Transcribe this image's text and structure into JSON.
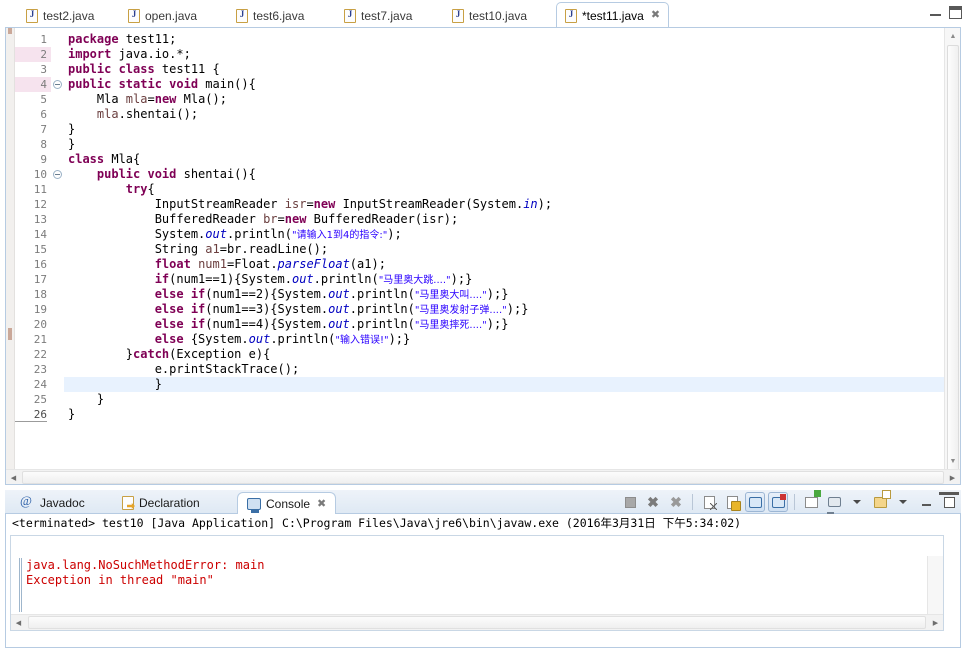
{
  "editor": {
    "tabs": [
      {
        "label": "test2.java",
        "icon": "java-file-icon",
        "active": false,
        "dirty": false
      },
      {
        "label": "open.java",
        "icon": "java-file-icon",
        "active": false,
        "dirty": false
      },
      {
        "label": "test6.java",
        "icon": "java-file-icon",
        "active": false,
        "dirty": false
      },
      {
        "label": "test7.java",
        "icon": "java-file-icon",
        "active": false,
        "dirty": false
      },
      {
        "label": "test10.java",
        "icon": "java-file-icon",
        "active": false,
        "dirty": false
      },
      {
        "label": "*test11.java",
        "icon": "java-file-icon",
        "active": true,
        "dirty": true,
        "close": "✖"
      }
    ],
    "window_buttons": {
      "minimize": "minimize-icon",
      "maximize": "maximize-icon"
    },
    "current_line": 24,
    "highlighted_gutter_lines": [
      2,
      4
    ],
    "fold_lines": [
      4,
      10
    ],
    "change_bar_lines": [
      10,
      25
    ],
    "lines": [
      {
        "n": 1,
        "segments": [
          {
            "t": "package ",
            "c": "kw"
          },
          {
            "t": "test11;",
            "c": ""
          }
        ]
      },
      {
        "n": 2,
        "segments": [
          {
            "t": "import ",
            "c": "kw"
          },
          {
            "t": "java.io.*;",
            "c": ""
          }
        ]
      },
      {
        "n": 3,
        "segments": [
          {
            "t": "public class ",
            "c": "kw"
          },
          {
            "t": "test11 {",
            "c": ""
          }
        ]
      },
      {
        "n": 4,
        "segments": [
          {
            "t": "public static void ",
            "c": "kw"
          },
          {
            "t": "main(){",
            "c": ""
          }
        ]
      },
      {
        "n": 5,
        "segments": [
          {
            "t": "    Mla ",
            "c": ""
          },
          {
            "t": "mla",
            "c": "loc"
          },
          {
            "t": "=",
            "c": ""
          },
          {
            "t": "new ",
            "c": "kw"
          },
          {
            "t": "Mla();",
            "c": ""
          }
        ]
      },
      {
        "n": 6,
        "segments": [
          {
            "t": "    ",
            "c": ""
          },
          {
            "t": "mla",
            "c": "loc"
          },
          {
            "t": ".shentai();",
            "c": ""
          }
        ]
      },
      {
        "n": 7,
        "segments": [
          {
            "t": "}",
            "c": ""
          }
        ]
      },
      {
        "n": 8,
        "segments": [
          {
            "t": "}",
            "c": ""
          }
        ]
      },
      {
        "n": 9,
        "segments": [
          {
            "t": "class ",
            "c": "kw"
          },
          {
            "t": "Mla{",
            "c": ""
          }
        ]
      },
      {
        "n": 10,
        "segments": [
          {
            "t": "    ",
            "c": ""
          },
          {
            "t": "public void ",
            "c": "kw"
          },
          {
            "t": "shentai(){",
            "c": ""
          }
        ]
      },
      {
        "n": 11,
        "segments": [
          {
            "t": "        ",
            "c": ""
          },
          {
            "t": "try",
            "c": "kw"
          },
          {
            "t": "{",
            "c": ""
          }
        ]
      },
      {
        "n": 12,
        "segments": [
          {
            "t": "            InputStreamReader ",
            "c": ""
          },
          {
            "t": "isr",
            "c": "loc"
          },
          {
            "t": "=",
            "c": ""
          },
          {
            "t": "new ",
            "c": "kw"
          },
          {
            "t": "InputStreamReader(System.",
            "c": ""
          },
          {
            "t": "in",
            "c": "fld"
          },
          {
            "t": ");",
            "c": ""
          }
        ]
      },
      {
        "n": 13,
        "segments": [
          {
            "t": "            BufferedReader ",
            "c": ""
          },
          {
            "t": "br",
            "c": "loc"
          },
          {
            "t": "=",
            "c": ""
          },
          {
            "t": "new ",
            "c": "kw"
          },
          {
            "t": "BufferedReader(isr);",
            "c": ""
          }
        ]
      },
      {
        "n": 14,
        "segments": [
          {
            "t": "            System.",
            "c": ""
          },
          {
            "t": "out",
            "c": "fld"
          },
          {
            "t": ".println(",
            "c": ""
          },
          {
            "t": "\"请输入1到4的指令:\"",
            "c": "str cjk"
          },
          {
            "t": ");",
            "c": ""
          }
        ]
      },
      {
        "n": 15,
        "segments": [
          {
            "t": "            String ",
            "c": ""
          },
          {
            "t": "a1",
            "c": "loc"
          },
          {
            "t": "=br.readLine();",
            "c": ""
          }
        ]
      },
      {
        "n": 16,
        "segments": [
          {
            "t": "            ",
            "c": ""
          },
          {
            "t": "float ",
            "c": "kw"
          },
          {
            "t": "num1",
            "c": "loc"
          },
          {
            "t": "=Float.",
            "c": ""
          },
          {
            "t": "parseFloat",
            "c": "fld"
          },
          {
            "t": "(a1);",
            "c": ""
          }
        ]
      },
      {
        "n": 17,
        "segments": [
          {
            "t": "            ",
            "c": ""
          },
          {
            "t": "if",
            "c": "kw"
          },
          {
            "t": "(num1==1){System.",
            "c": ""
          },
          {
            "t": "out",
            "c": "fld"
          },
          {
            "t": ".println(",
            "c": ""
          },
          {
            "t": "\"马里奥大跳....\"",
            "c": "str cjk"
          },
          {
            "t": ");}",
            "c": ""
          }
        ]
      },
      {
        "n": 18,
        "segments": [
          {
            "t": "            ",
            "c": ""
          },
          {
            "t": "else if",
            "c": "kw"
          },
          {
            "t": "(num1==2){System.",
            "c": ""
          },
          {
            "t": "out",
            "c": "fld"
          },
          {
            "t": ".println(",
            "c": ""
          },
          {
            "t": "\"马里奥大叫....\"",
            "c": "str cjk"
          },
          {
            "t": ");}",
            "c": ""
          }
        ]
      },
      {
        "n": 19,
        "segments": [
          {
            "t": "            ",
            "c": ""
          },
          {
            "t": "else if",
            "c": "kw"
          },
          {
            "t": "(num1==3){System.",
            "c": ""
          },
          {
            "t": "out",
            "c": "fld"
          },
          {
            "t": ".println(",
            "c": ""
          },
          {
            "t": "\"马里奥发射子弹....\"",
            "c": "str cjk"
          },
          {
            "t": ");}",
            "c": ""
          }
        ]
      },
      {
        "n": 20,
        "segments": [
          {
            "t": "            ",
            "c": ""
          },
          {
            "t": "else if",
            "c": "kw"
          },
          {
            "t": "(num1==4){System.",
            "c": ""
          },
          {
            "t": "out",
            "c": "fld"
          },
          {
            "t": ".println(",
            "c": ""
          },
          {
            "t": "\"马里奥摔死....\"",
            "c": "str cjk"
          },
          {
            "t": ");}",
            "c": ""
          }
        ]
      },
      {
        "n": 21,
        "segments": [
          {
            "t": "            ",
            "c": ""
          },
          {
            "t": "else ",
            "c": "kw"
          },
          {
            "t": "{System.",
            "c": ""
          },
          {
            "t": "out",
            "c": "fld"
          },
          {
            "t": ".println(",
            "c": ""
          },
          {
            "t": "\"输入错误!\"",
            "c": "str cjk"
          },
          {
            "t": ");}",
            "c": ""
          }
        ]
      },
      {
        "n": 22,
        "segments": [
          {
            "t": "        }",
            "c": ""
          },
          {
            "t": "catch",
            "c": "kw"
          },
          {
            "t": "(Exception e){",
            "c": ""
          }
        ]
      },
      {
        "n": 23,
        "segments": [
          {
            "t": "            e.printStackTrace();",
            "c": ""
          }
        ]
      },
      {
        "n": 24,
        "segments": [
          {
            "t": "            }",
            "c": ""
          }
        ]
      },
      {
        "n": 25,
        "segments": [
          {
            "t": "    }",
            "c": ""
          }
        ]
      },
      {
        "n": 26,
        "segments": [
          {
            "t": "}",
            "c": ""
          }
        ]
      }
    ],
    "scrollbar": {
      "vertical_up": "▲",
      "vertical_down": "▼",
      "horizontal_left": "◀",
      "horizontal_right": "▶"
    }
  },
  "console": {
    "tabs": [
      {
        "label": "Javadoc",
        "icon": "javadoc-at-icon",
        "active": false
      },
      {
        "label": "Declaration",
        "icon": "declaration-icon",
        "active": false
      },
      {
        "label": "Console",
        "icon": "console-screen-icon",
        "active": true,
        "close": "✖"
      }
    ],
    "toolbar": [
      {
        "name": "terminate-button",
        "icon": "stop-square-icon",
        "pressed": false
      },
      {
        "name": "remove-launch-button",
        "icon": "remove-x-icon",
        "pressed": false
      },
      {
        "name": "remove-all-terminated-button",
        "icon": "remove-all-x-icon",
        "pressed": false
      },
      {
        "name": "clear-console-button",
        "icon": "clear-console-icon",
        "pressed": false
      },
      {
        "name": "scroll-lock-button",
        "icon": "scroll-lock-icon",
        "pressed": false
      },
      {
        "name": "show-console-on-output-button",
        "icon": "console-out-icon",
        "pressed": true
      },
      {
        "name": "show-console-on-error-button",
        "icon": "console-error-icon",
        "pressed": true
      },
      {
        "name": "pin-console-button",
        "icon": "pin-console-icon",
        "pressed": false
      },
      {
        "name": "display-selected-console-button",
        "icon": "display-console-icon",
        "pressed": false
      },
      {
        "name": "display-console-menu-button",
        "icon": "chevron-down-icon",
        "pressed": false
      },
      {
        "name": "open-console-button",
        "icon": "open-console-folder-icon",
        "pressed": false
      },
      {
        "name": "open-console-menu-button",
        "icon": "chevron-down-icon",
        "pressed": false
      },
      {
        "name": "minimize-view-button",
        "icon": "minimize-icon",
        "pressed": false
      },
      {
        "name": "maximize-view-button",
        "icon": "maximize-icon",
        "pressed": false
      }
    ],
    "launch_line": "<terminated> test10 [Java Application] C:\\Program Files\\Java\\jre6\\bin\\javaw.exe (2016年3月31日 下午5:34:02)",
    "output_lines": [
      "java.lang.NoSuchMethodError: main",
      "Exception in thread \"main\""
    ],
    "output_color": "#cc0000"
  },
  "colors": {
    "keyword": "#7f0055",
    "string": "#2a00ff",
    "field": "#0000c0",
    "local_var": "#6a3e3e",
    "current_line_bg": "#e8f2fe",
    "tab_border": "#b6cbe2",
    "error_text": "#cc0000"
  }
}
